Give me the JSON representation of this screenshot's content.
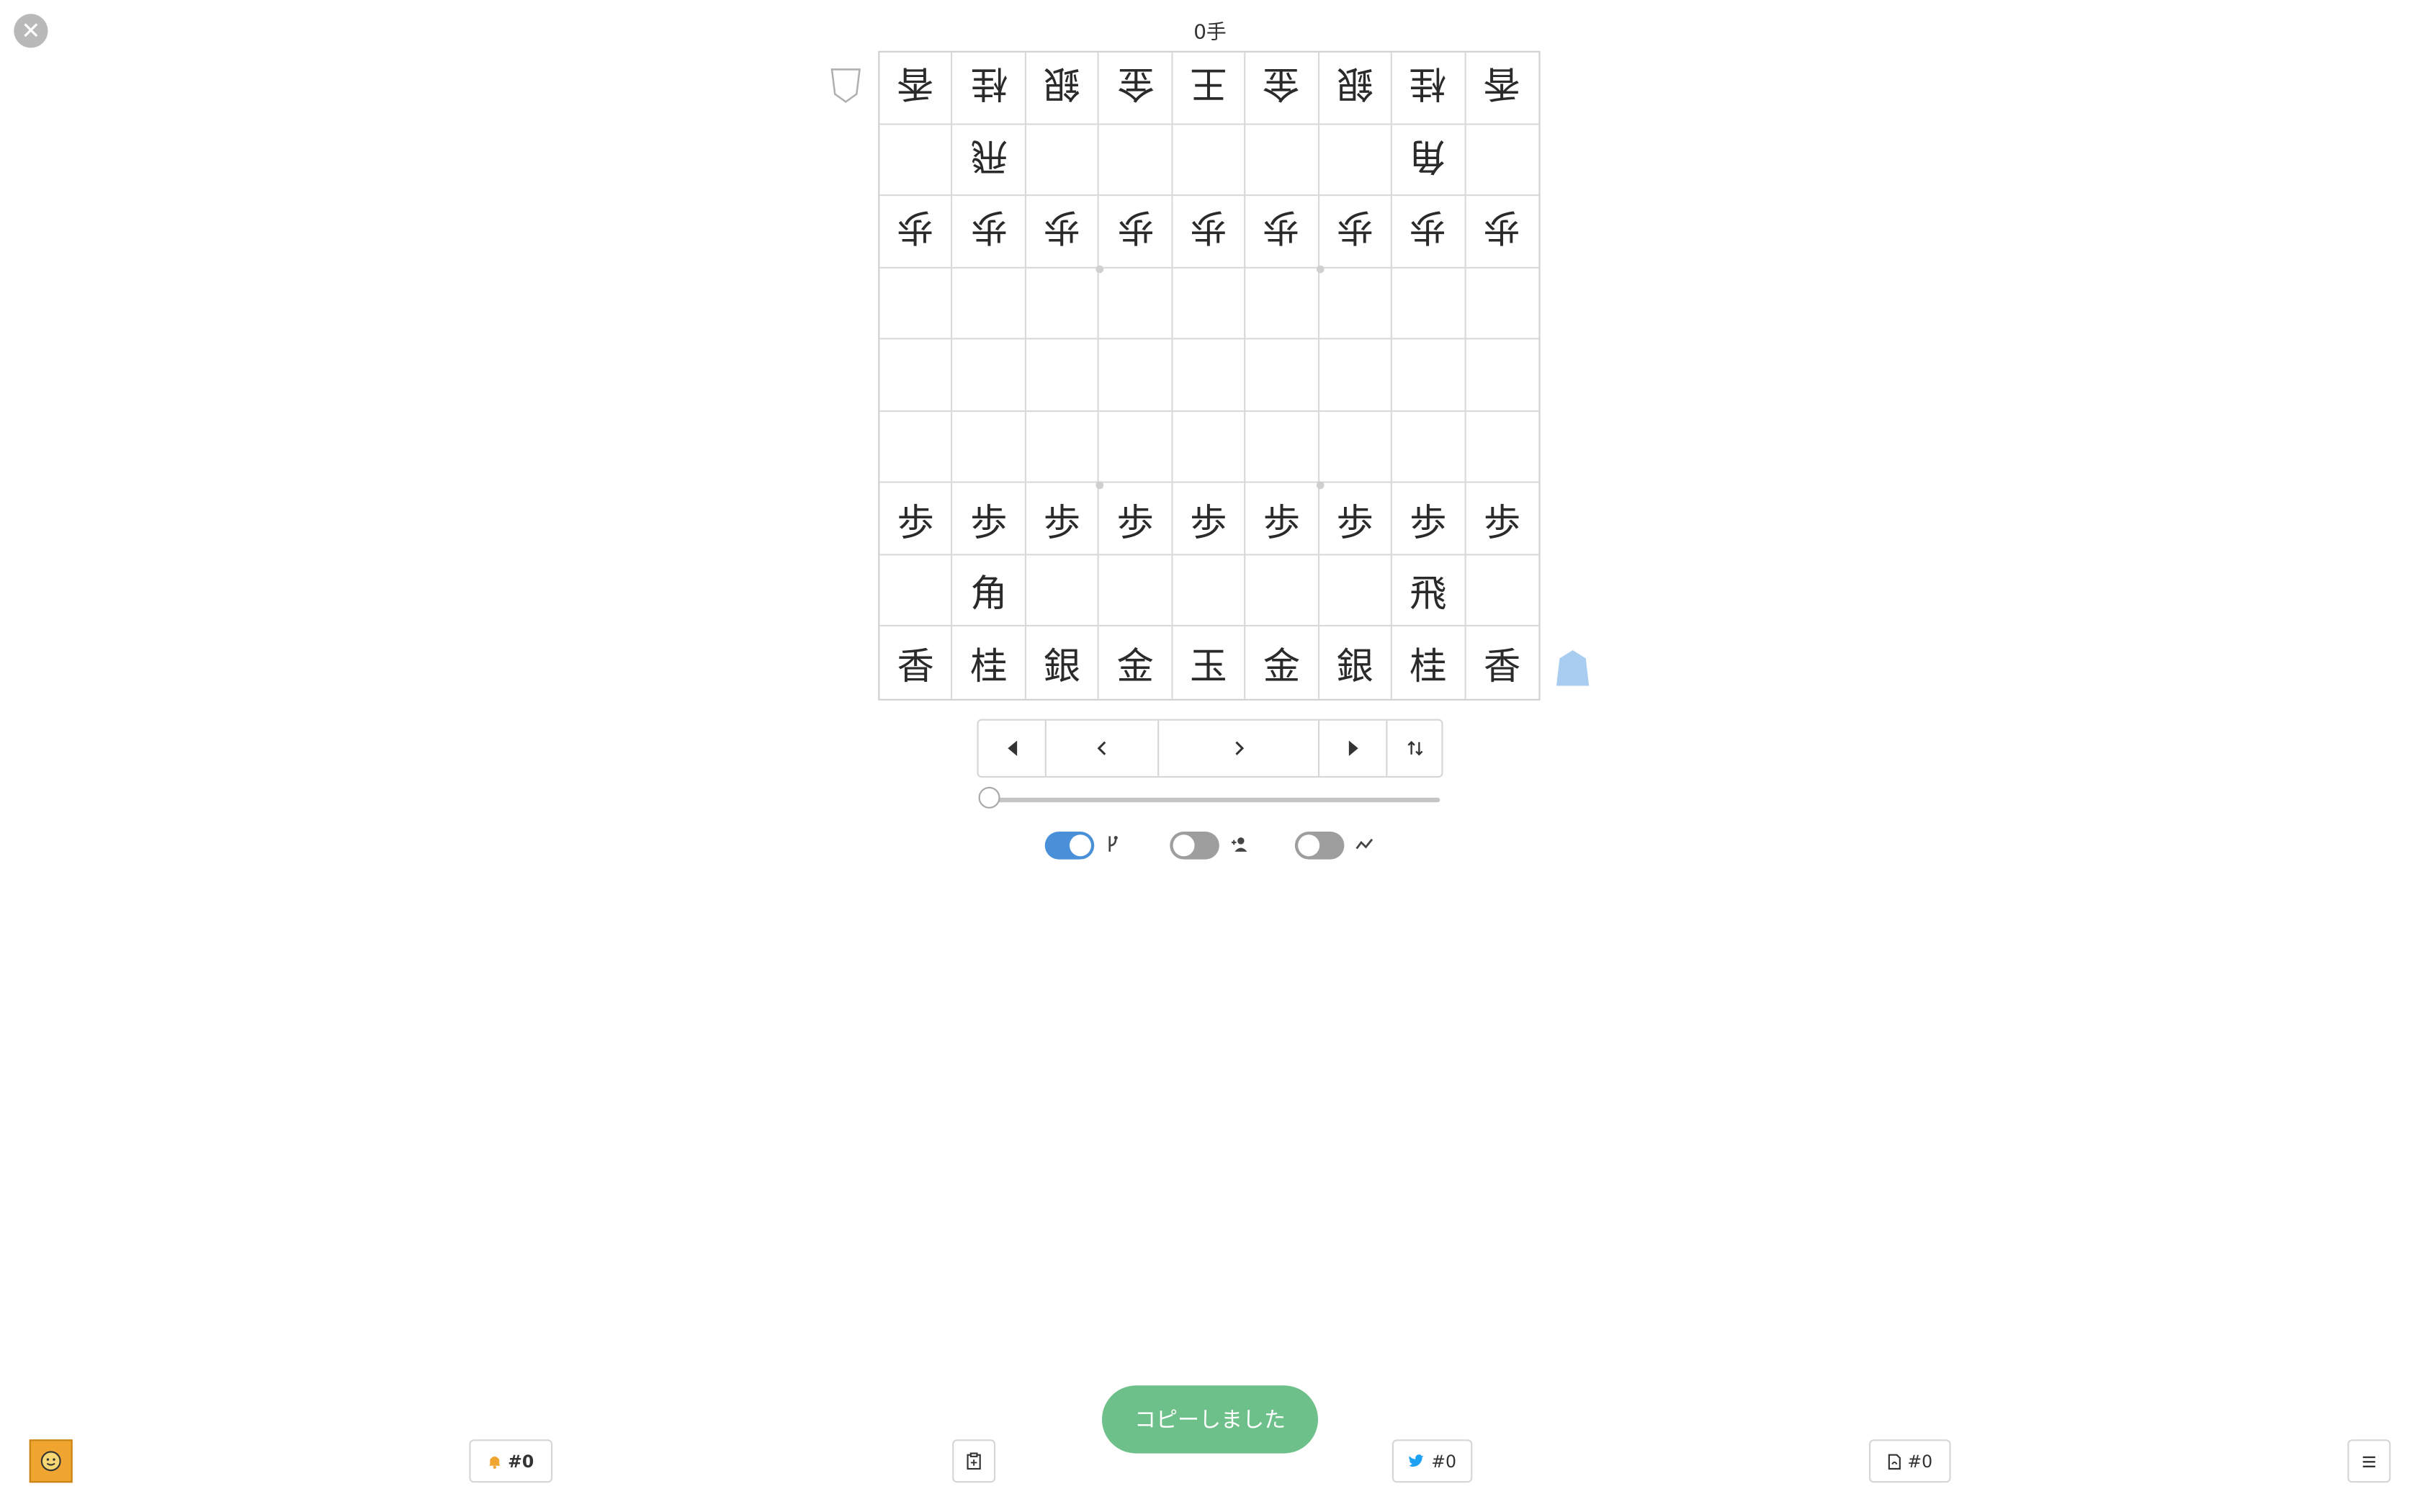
{
  "header": {
    "close_icon": "close-icon",
    "move_count": "0手"
  },
  "board": {
    "rows": [
      [
        "香",
        "桂",
        "銀",
        "金",
        "王",
        "金",
        "銀",
        "桂",
        "香"
      ],
      [
        "",
        "飛",
        "",
        "",
        "",
        "",
        "",
        "角",
        ""
      ],
      [
        "歩",
        "歩",
        "歩",
        "歩",
        "歩",
        "歩",
        "歩",
        "歩",
        "歩"
      ],
      [
        "",
        "",
        "",
        "",
        "",
        "",
        "",
        "",
        ""
      ],
      [
        "",
        "",
        "",
        "",
        "",
        "",
        "",
        "",
        ""
      ],
      [
        "",
        "",
        "",
        "",
        "",
        "",
        "",
        "",
        ""
      ],
      [
        "歩",
        "歩",
        "歩",
        "歩",
        "歩",
        "歩",
        "歩",
        "歩",
        "歩"
      ],
      [
        "",
        "角",
        "",
        "",
        "",
        "",
        "",
        "飛",
        ""
      ],
      [
        "香",
        "桂",
        "銀",
        "金",
        "玉",
        "金",
        "銀",
        "桂",
        "香"
      ]
    ],
    "gote_rows": [
      0,
      1,
      2
    ],
    "gote_stand_icon": "gote-piece-stand-icon",
    "sente_stand_icon": "sente-piece-stand-icon",
    "sente_color": "#a8cdf0"
  },
  "controls": {
    "nav_first_icon": "first-move-icon",
    "nav_prev_icon": "previous-move-icon",
    "nav_next_icon": "next-move-icon",
    "nav_last_icon": "last-move-icon",
    "nav_flip_icon": "flip-board-icon",
    "slider_position": 0,
    "toggles": [
      {
        "icon": "branch-icon",
        "on": true
      },
      {
        "icon": "user-add-icon",
        "on": false
      },
      {
        "icon": "trend-icon",
        "on": false
      }
    ],
    "toggle_on_color": "#4a90d9",
    "toggle_off_color": "#9e9e9e"
  },
  "toast": {
    "text": "コピーしました",
    "color": "#6ec08a"
  },
  "footer": {
    "avatar_icon": "face-icon",
    "avatar_color": "#f0a531",
    "bell_label": "#0",
    "bell_icon": "bell-icon",
    "clipboard_icon": "clipboard-icon",
    "twitter_label": "#0",
    "twitter_icon": "twitter-icon",
    "twitter_color": "#1da1f2",
    "document_label": "#0",
    "document_icon": "document-icon",
    "menu_icon": "menu-icon"
  }
}
